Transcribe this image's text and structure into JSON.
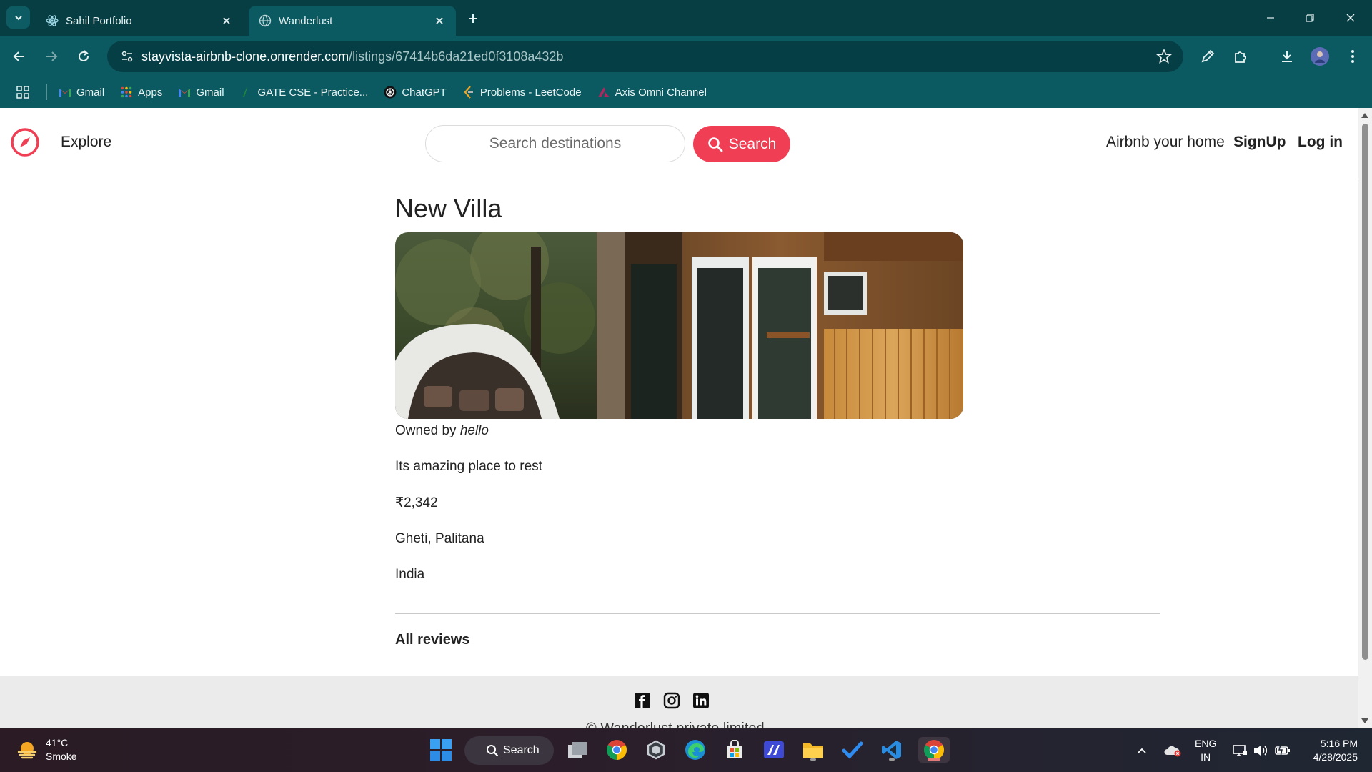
{
  "browser": {
    "tabs": [
      {
        "title": "Sahil Portfolio",
        "active": false
      },
      {
        "title": "Wanderlust",
        "active": true
      }
    ],
    "url_host": "stayvista-airbnb-clone.onrender.com",
    "url_path": "/listings/67414b6da21ed0f3108a432b",
    "bookmarks": [
      {
        "label": "Gmail",
        "icon": "gmail-icon"
      },
      {
        "label": "Apps",
        "icon": "apps-grid-icon"
      },
      {
        "label": "Gmail",
        "icon": "gmail-icon"
      },
      {
        "label": "GATE CSE - Practice...",
        "icon": "gate-icon"
      },
      {
        "label": "ChatGPT",
        "icon": "chatgpt-icon"
      },
      {
        "label": "Problems - LeetCode",
        "icon": "leetcode-icon"
      },
      {
        "label": "Axis Omni Channel",
        "icon": "axis-icon"
      }
    ]
  },
  "site_nav": {
    "explore_label": "Explore",
    "search_placeholder": "Search destinations",
    "search_button": "Search",
    "host_link": "Airbnb your home",
    "signup_link": "SignUp",
    "login_link": "Log in"
  },
  "listing": {
    "title": "New Villa",
    "owner_prefix": "Owned by",
    "owner_name": "hello",
    "description": "Its amazing place to rest",
    "price": "₹2,342",
    "location": "Gheti, Palitana",
    "country": "India"
  },
  "reviews": {
    "heading": "All reviews"
  },
  "footer": {
    "copyright": "© Wanderlust private limited"
  },
  "taskbar": {
    "temperature": "41°C",
    "condition": "Smoke",
    "search_label": "Search",
    "language": "ENG",
    "region": "IN",
    "time": "5:16 PM",
    "date": "4/28/2025"
  },
  "colors": {
    "brand_red": "#f03f55",
    "chrome_teal": "#0c5a61",
    "tabstrip_teal": "#063e44"
  }
}
